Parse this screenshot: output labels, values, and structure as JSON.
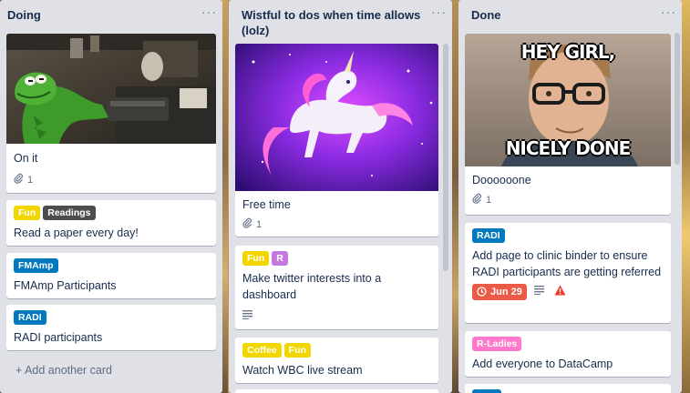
{
  "lists": [
    {
      "title": "Doing",
      "menu": "···",
      "cards": [
        {
          "title": "On it",
          "attachments": "1"
        },
        {
          "labels": [
            {
              "text": "Fun",
              "color": "#f2d600"
            },
            {
              "text": "Readings",
              "color": "#4d4d4d"
            }
          ],
          "title": "Read a paper every day!"
        },
        {
          "labels": [
            {
              "text": "FMAmp",
              "color": "#0079bf"
            }
          ],
          "title": "FMAmp Participants"
        },
        {
          "labels": [
            {
              "text": "RADI",
              "color": "#0079bf"
            }
          ],
          "title": "RADI participants"
        }
      ],
      "add_card": "+ Add another card"
    },
    {
      "title": "Wistful to dos when time allows (lolz)",
      "menu": "···",
      "cards": [
        {
          "title": "Free time",
          "attachments": "1"
        },
        {
          "labels": [
            {
              "text": "Fun",
              "color": "#f2d600"
            },
            {
              "text": "R",
              "color": "#c377e0"
            }
          ],
          "title": "Make twitter interests into a dashboard"
        },
        {
          "labels": [
            {
              "text": "Coffee",
              "color": "#f2d600"
            },
            {
              "text": "Fun",
              "color": "#f2d600"
            }
          ],
          "title": "Watch WBC live stream"
        }
      ]
    },
    {
      "title": "Done",
      "menu": "···",
      "cards": [
        {
          "meme_top": "HEY GIRL,",
          "meme_bottom": "NICELY DONE",
          "title": "Doooooone",
          "attachments": "1"
        },
        {
          "labels": [
            {
              "text": "RADI",
              "color": "#0079bf"
            }
          ],
          "title": "Add page to clinic binder to ensure RADI participants are getting referred",
          "due": "Jun 29"
        },
        {
          "labels": [
            {
              "text": "R-Ladies",
              "color": "#ff78cb"
            }
          ],
          "title": "Add everyone to DataCamp"
        },
        {
          "labels": [
            {
              "text": "",
              "color": "#0079bf"
            }
          ]
        }
      ]
    }
  ],
  "colors": {
    "list_bg": "#dfe1e6",
    "card_bg": "#ffffff",
    "due_overdue": "#eb5a46",
    "warning": "#eb3b2f"
  },
  "icons": {
    "attachment": "paperclip-icon",
    "description": "description-icon",
    "due": "clock-icon",
    "warning": "warning-icon",
    "menu": "more-horizontal-icon"
  }
}
